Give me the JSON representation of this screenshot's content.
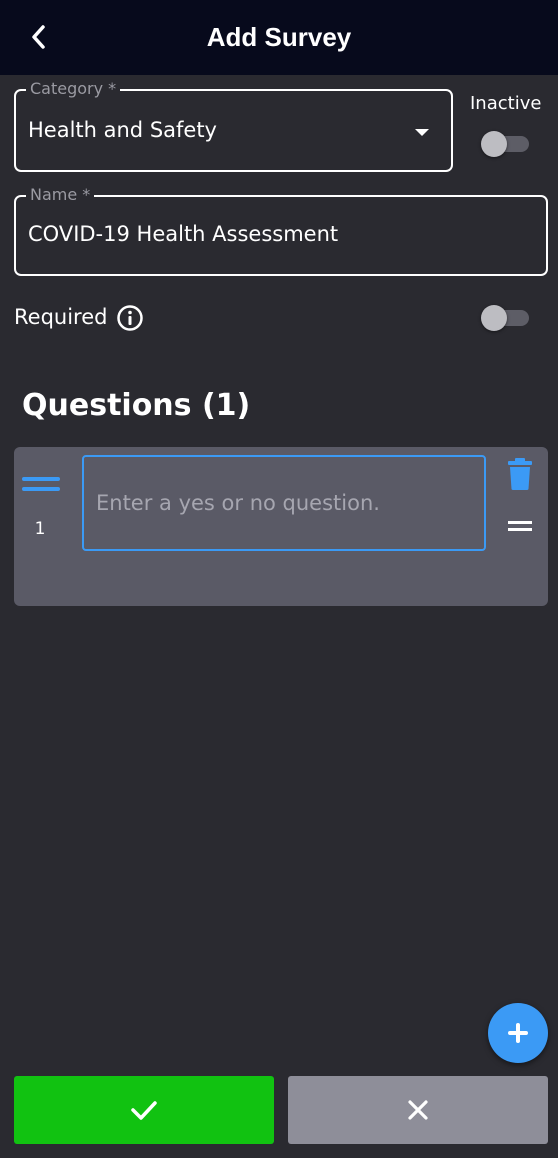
{
  "header": {
    "title": "Add Survey",
    "back_icon": "chevron-left-icon"
  },
  "form": {
    "category": {
      "label": "Category *",
      "value": "Health and Safety"
    },
    "inactive": {
      "label": "Inactive",
      "on": false
    },
    "name": {
      "label": "Name *",
      "value": "COVID-19 Health Assessment"
    },
    "required": {
      "label": "Required",
      "on": false,
      "icon": "info-icon"
    }
  },
  "questions": {
    "title": "Questions (1)",
    "items": [
      {
        "number": "1",
        "placeholder": "Enter a yes or no question.",
        "value": ""
      }
    ]
  },
  "actions": {
    "add_icon": "plus-icon",
    "confirm_icon": "check-icon",
    "cancel_icon": "close-icon"
  },
  "colors": {
    "header_bg": "#070a1c",
    "page_bg": "#2a2a30",
    "accent": "#3b9af5",
    "confirm": "#11c211",
    "cancel": "#8e8e99",
    "card_bg": "#5a5a66"
  }
}
